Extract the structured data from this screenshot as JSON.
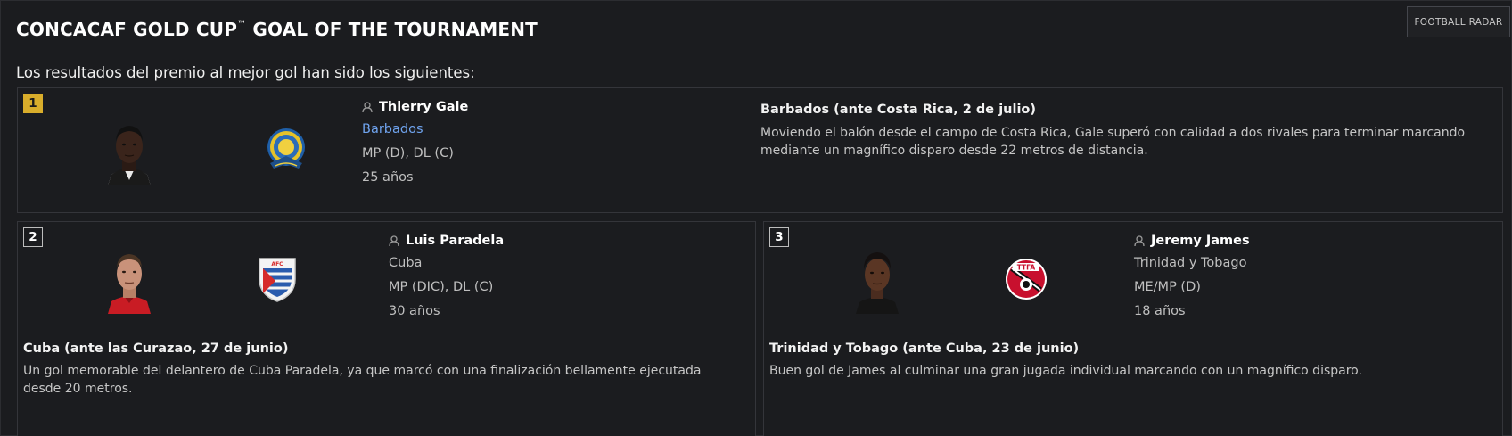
{
  "header": {
    "title": "CONCACAF GOLD CUP",
    "title_mark": "™",
    "title_rest": " GOAL OF THE TOURNAMENT",
    "radar_button": "FOOTBALL RADAR",
    "subtitle": "Los resultados del premio al mejor gol han sido los siguientes:"
  },
  "colors": {
    "background": "#1b1c1f",
    "rank_gold": "#d9ad2b",
    "link": "#6fa3ee"
  },
  "goals": [
    {
      "rank": "1",
      "player": "Thierry Gale",
      "nation": "Barbados",
      "positions": "MP (D), DL (C)",
      "age": "25 años",
      "goal_title": "Barbados (ante Costa Rica, 2 de julio)",
      "goal_desc": "Moviendo el balón desde el campo de Costa Rica, Gale superó con calidad a dos rivales para terminar marcando mediante un magnífico disparo desde 22 metros de distancia."
    },
    {
      "rank": "2",
      "player": "Luis Paradela",
      "nation": "Cuba",
      "positions": "MP (DIC), DL (C)",
      "age": "30 años",
      "goal_title": "Cuba (ante las Curazao, 27 de junio)",
      "goal_desc": "Un gol memorable del delantero de Cuba Paradela, ya que marcó con una finalización bellamente ejecutada desde 20 metros."
    },
    {
      "rank": "3",
      "player": "Jeremy James",
      "nation": "Trinidad y Tobago",
      "positions": "ME/MP (D)",
      "age": "18 años",
      "goal_title": "Trinidad y Tobago (ante Cuba, 23 de junio)",
      "goal_desc": "Buen gol de James al culminar una gran jugada individual marcando con un magnífico disparo."
    }
  ],
  "icons": {
    "person": "person-icon",
    "crest_barbados": "barbados-crest-icon",
    "crest_cuba": "cuba-crest-icon",
    "crest_tt": "trinidad-tobago-crest-icon"
  },
  "crest_text": {
    "cuba": "AFC",
    "tt": "TTFA"
  }
}
